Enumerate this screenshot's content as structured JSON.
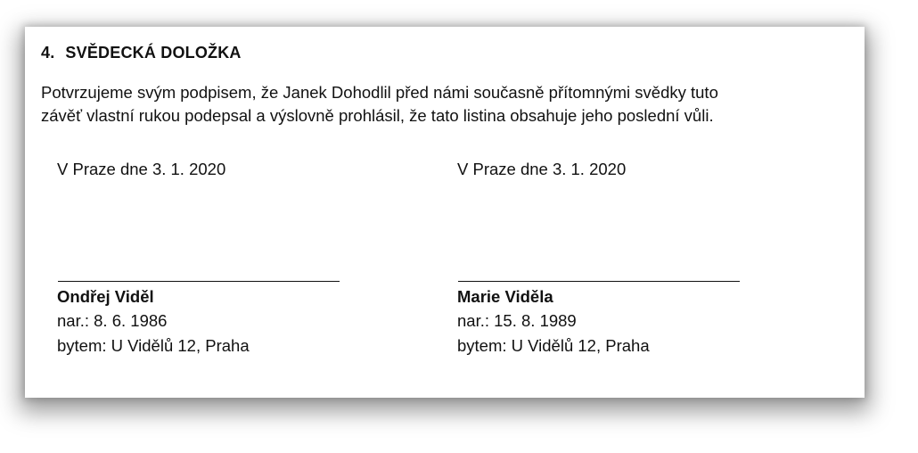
{
  "section": {
    "number": "4.",
    "title": "SVĚDECKÁ DOLOŽKA"
  },
  "body": {
    "line1": "Potvrzujeme svým podpisem, že Janek Dohodlil před námi současně přítomnými svědky tuto",
    "line2": "závěť vlastní rukou podepsal a výslovně prohlásil, že tato listina obsahuje jeho poslední vůli."
  },
  "witnesses": [
    {
      "place_date": "V Praze dne 3. 1. 2020",
      "name": "Ondřej Viděl",
      "born": "nar.: 8. 6. 1986",
      "address": "bytem: U Vidělů 12, Praha"
    },
    {
      "place_date": "V Praze dne 3. 1. 2020",
      "name": "Marie Viděla",
      "born": "nar.: 15. 8. 1989",
      "address": "bytem: U Vidělů 12, Praha"
    }
  ]
}
